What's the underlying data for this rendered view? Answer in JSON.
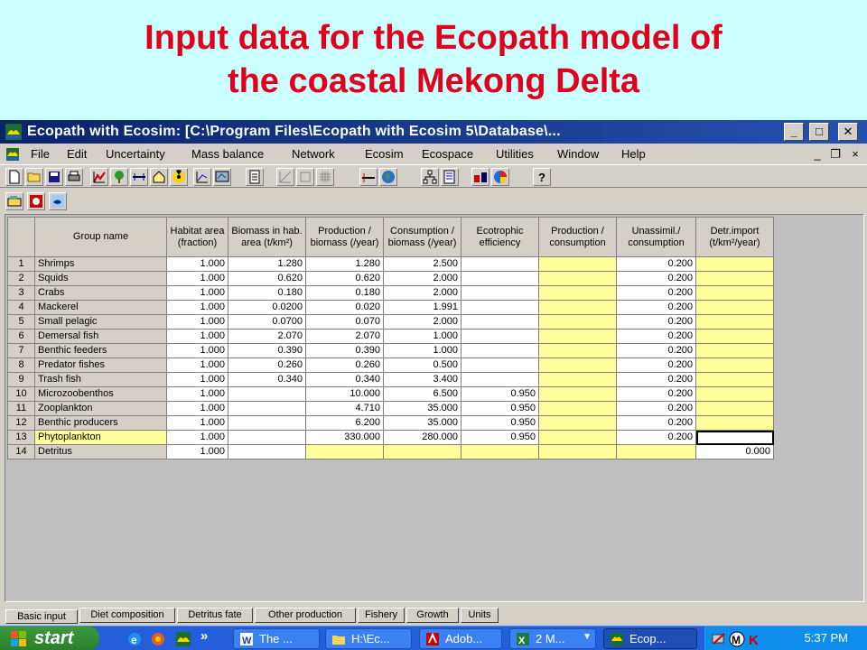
{
  "slide": {
    "title_line1": "Input data for the Ecopath model of",
    "title_line2": "the coastal Mekong Delta"
  },
  "window": {
    "title": "Ecopath with Ecosim: [C:\\Program Files\\Ecopath with Ecosim 5\\Database\\...",
    "minimize": "_",
    "maximize": "□",
    "close": "✕"
  },
  "menu": [
    "File",
    "Edit",
    "Uncertainty",
    "Mass balance",
    "Network",
    "Ecosim",
    "Ecospace",
    "Utilities",
    "Window",
    "Help"
  ],
  "mdi": {
    "minimize": "_",
    "restore": "❐",
    "close": "×"
  },
  "table": {
    "headers": [
      "",
      "Group name",
      "Habitat area (fraction)",
      "Biomass in hab. area (t/km²)",
      "Production / biomass (/year)",
      "Consumption / biomass (/year)",
      "Ecotrophic efficiency",
      "Production / consumption",
      "Unassimil./ consumption",
      "Detr.import (t/km²/year)"
    ],
    "rows": [
      {
        "n": "1",
        "name": "Shrimps",
        "ha": "1.000",
        "b": "1.280",
        "pb": "1.280",
        "qb": "2.500",
        "ee": "",
        "pq": "",
        "un": "0.200",
        "di": ""
      },
      {
        "n": "2",
        "name": "Squids",
        "ha": "1.000",
        "b": "0.620",
        "pb": "0.620",
        "qb": "2.000",
        "ee": "",
        "pq": "",
        "un": "0.200",
        "di": ""
      },
      {
        "n": "3",
        "name": "Crabs",
        "ha": "1.000",
        "b": "0.180",
        "pb": "0.180",
        "qb": "2.000",
        "ee": "",
        "pq": "",
        "un": "0.200",
        "di": ""
      },
      {
        "n": "4",
        "name": "Mackerel",
        "ha": "1.000",
        "b": "0.0200",
        "pb": "0.020",
        "qb": "1.991",
        "ee": "",
        "pq": "",
        "un": "0.200",
        "di": ""
      },
      {
        "n": "5",
        "name": "Small pelagic",
        "ha": "1.000",
        "b": "0.0700",
        "pb": "0.070",
        "qb": "2.000",
        "ee": "",
        "pq": "",
        "un": "0.200",
        "di": ""
      },
      {
        "n": "6",
        "name": "Demersal fish",
        "ha": "1.000",
        "b": "2.070",
        "pb": "2.070",
        "qb": "1.000",
        "ee": "",
        "pq": "",
        "un": "0.200",
        "di": ""
      },
      {
        "n": "7",
        "name": "Benthic feeders",
        "ha": "1.000",
        "b": "0.390",
        "pb": "0.390",
        "qb": "1.000",
        "ee": "",
        "pq": "",
        "un": "0.200",
        "di": ""
      },
      {
        "n": "8",
        "name": "Predator fishes",
        "ha": "1.000",
        "b": "0.260",
        "pb": "0.260",
        "qb": "0.500",
        "ee": "",
        "pq": "",
        "un": "0.200",
        "di": ""
      },
      {
        "n": "9",
        "name": "Trash fish",
        "ha": "1.000",
        "b": "0.340",
        "pb": "0.340",
        "qb": "3.400",
        "ee": "",
        "pq": "",
        "un": "0.200",
        "di": ""
      },
      {
        "n": "10",
        "name": "Microzoobenthos",
        "ha": "1.000",
        "b": "",
        "pb": "10.000",
        "qb": "6.500",
        "ee": "0.950",
        "pq": "",
        "un": "0.200",
        "di": ""
      },
      {
        "n": "11",
        "name": "Zooplankton",
        "ha": "1.000",
        "b": "",
        "pb": "4.710",
        "qb": "35.000",
        "ee": "0.950",
        "pq": "",
        "un": "0.200",
        "di": ""
      },
      {
        "n": "12",
        "name": "Benthic producers",
        "ha": "1.000",
        "b": "",
        "pb": "6.200",
        "qb": "35.000",
        "ee": "0.950",
        "pq": "",
        "un": "0.200",
        "di": ""
      },
      {
        "n": "13",
        "name": "Phytoplankton",
        "ha": "1.000",
        "b": "",
        "pb": "330.000",
        "qb": "280.000",
        "ee": "0.950",
        "pq": "",
        "un": "0.200",
        "di": ""
      },
      {
        "n": "14",
        "name": "Detritus",
        "ha": "1.000",
        "b": "",
        "pb": "",
        "qb": "",
        "ee": "",
        "pq": "",
        "un": "",
        "di": "0.000"
      }
    ]
  },
  "tabs": [
    "Basic input",
    "Diet composition",
    "Detritus fate",
    "Other production",
    "Fishery",
    "Growth",
    "Units"
  ],
  "taskbar": {
    "start": "start",
    "chevron": "»",
    "tasks": [
      "The ...",
      "H:\\Ec...",
      "Adob...",
      "2 M...",
      "Ecop..."
    ],
    "clock": "5:37 PM"
  },
  "colors": {
    "slide_bg": "#ccffff",
    "title_red": "#e0001c",
    "window_chrome": "#d4d0c8",
    "cell_yellow": "#ffff99",
    "taskbar_blue": "#245edb"
  }
}
